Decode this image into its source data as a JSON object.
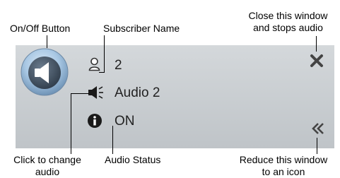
{
  "callouts": {
    "onoff": "On/Off Button",
    "subscriber": "Subscriber Name",
    "close_line1": "Close this window",
    "close_line2": "and stops audio",
    "change_line1": "Click to change",
    "change_line2": "audio",
    "status": "Audio Status",
    "reduce_line1": "Reduce this window",
    "reduce_line2": "to an icon"
  },
  "widget": {
    "subscriber_name": "2",
    "audio_label": "Audio 2",
    "status_value": "ON",
    "colors": {
      "panel": "#c8cdd1",
      "button_ring": "#9ec0df",
      "button_core": "#4e5e70"
    },
    "icons": {
      "onoff": "speaker-icon",
      "subscriber": "user-icon",
      "audio": "speaker-wave-icon",
      "status": "info-icon",
      "close": "close-icon",
      "minimize": "double-chevron-left-icon"
    }
  }
}
